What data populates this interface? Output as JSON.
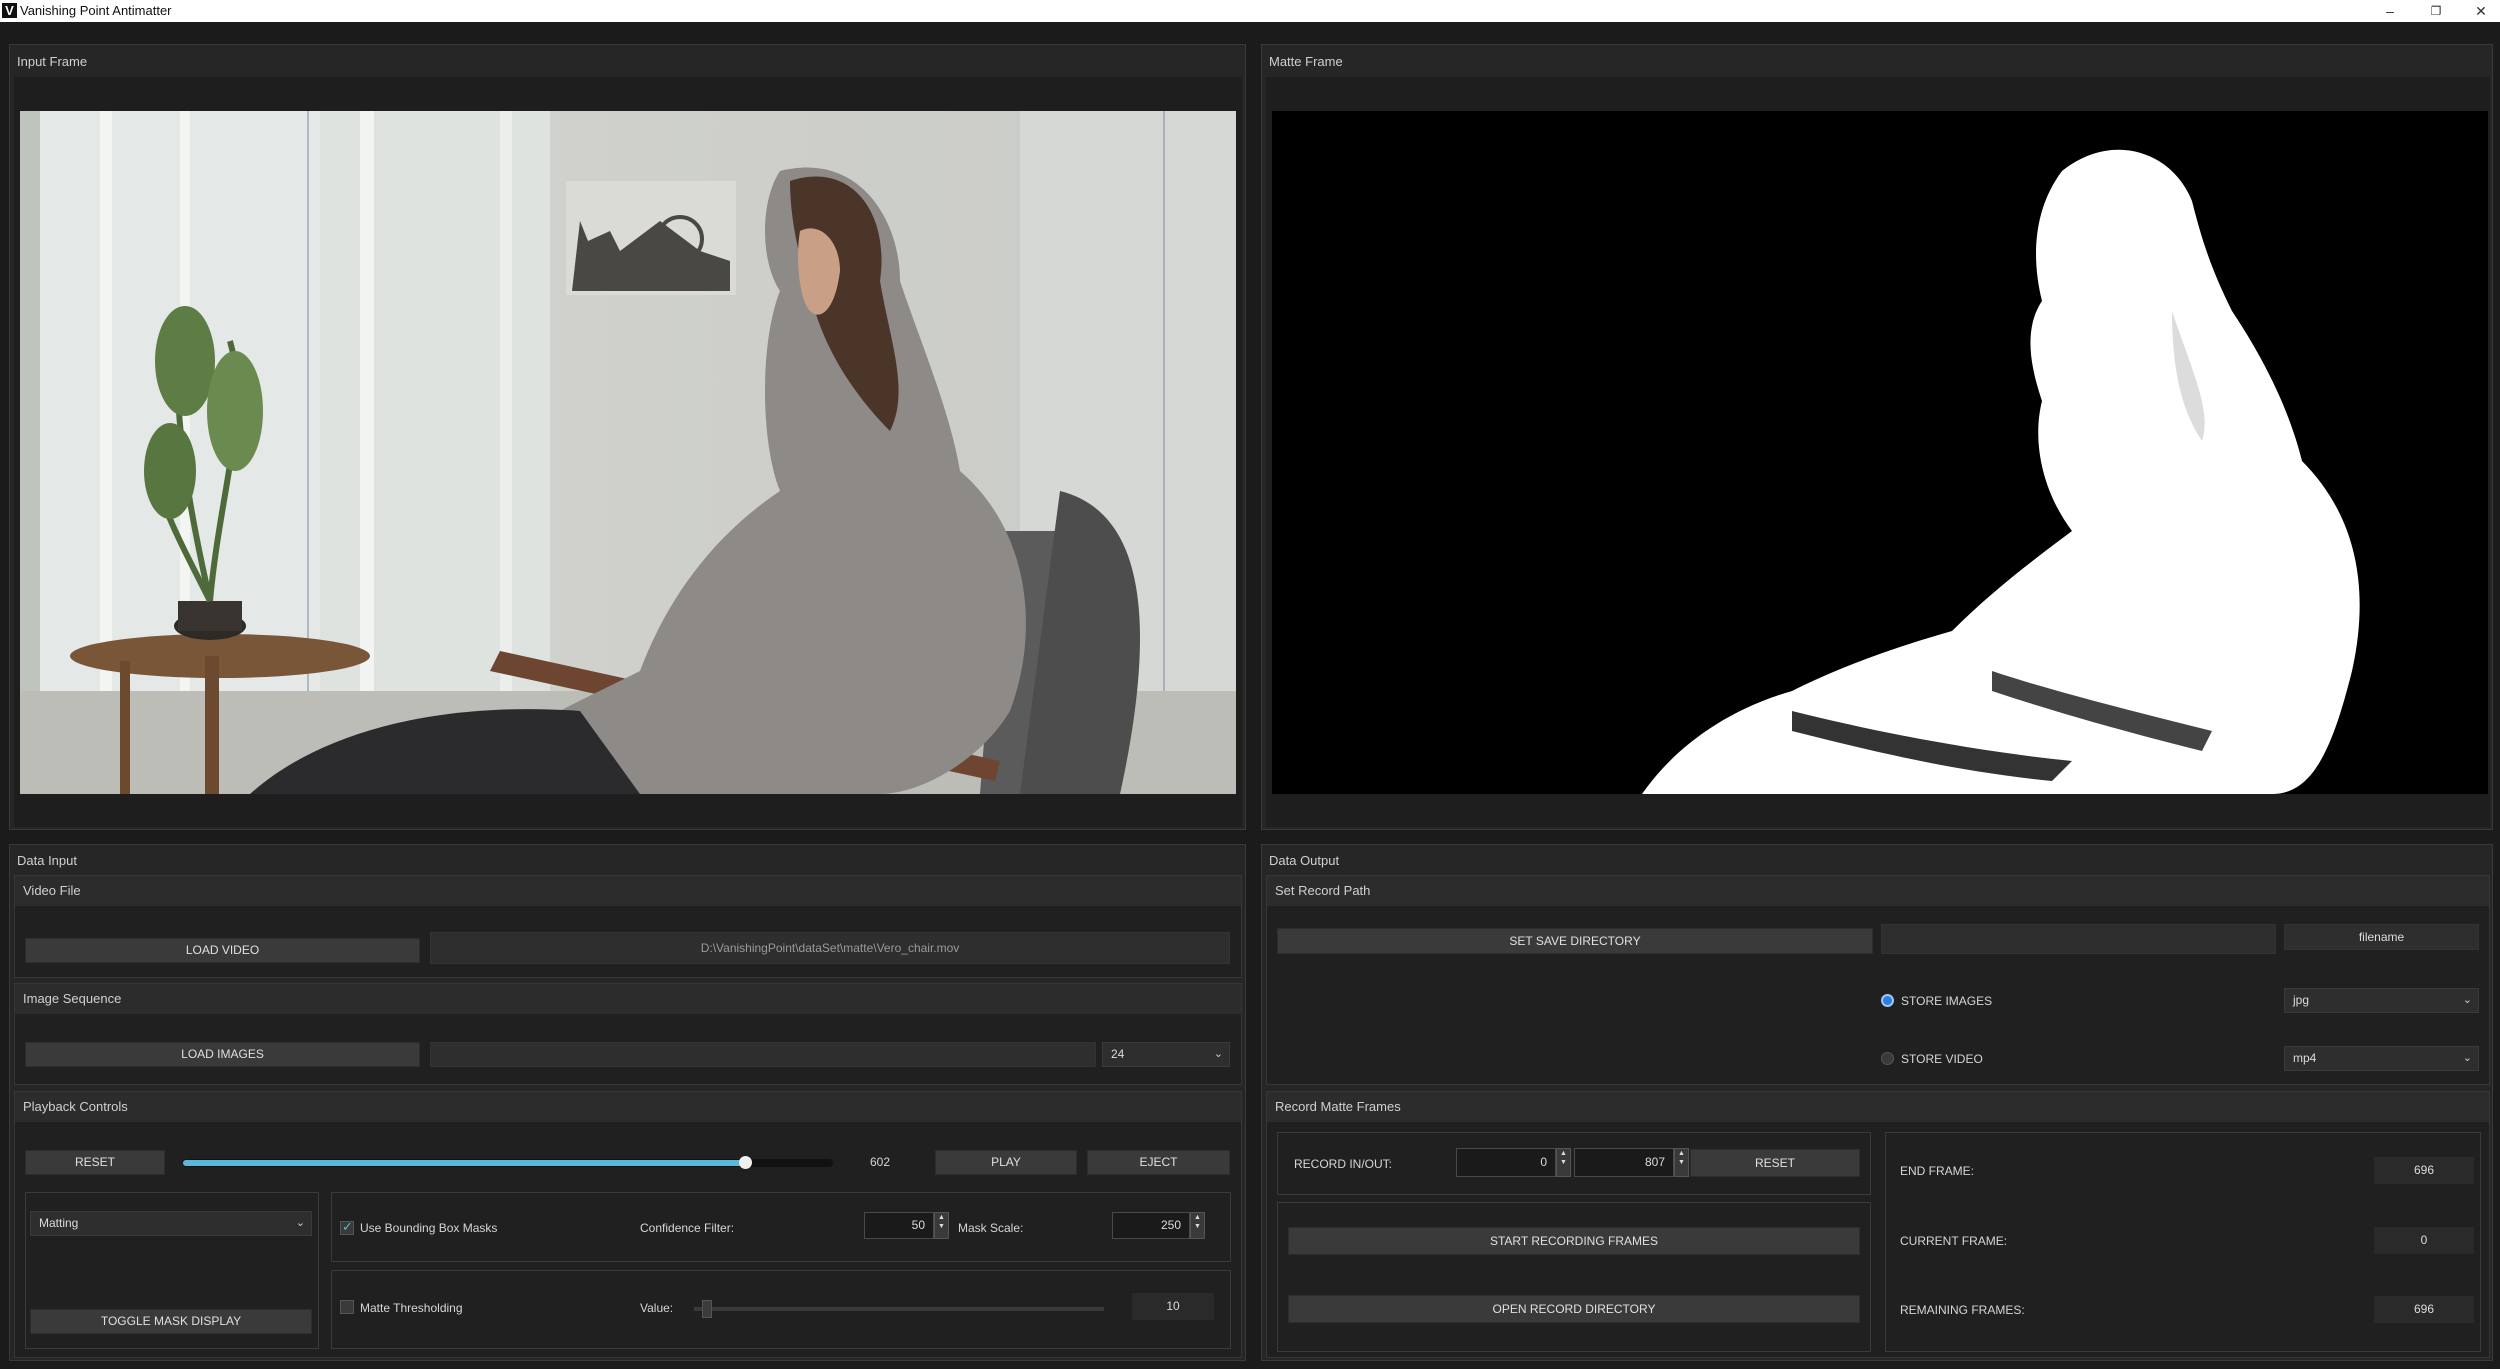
{
  "window": {
    "title": "Vanishing Point Antimatter",
    "logo": "V",
    "controls": {
      "minimize": "–",
      "restore": "❐",
      "close": "✕"
    }
  },
  "input_frame": {
    "title": "Input Frame"
  },
  "matte_frame": {
    "title": "Matte Frame"
  },
  "data_input": {
    "title": "Data Input",
    "video_file": {
      "header": "Video File",
      "load_button": "LOAD VIDEO",
      "path": "D:\\VanishingPoint\\dataSet\\matte\\Vero_chair.mov"
    },
    "image_sequence": {
      "header": "Image Sequence",
      "load_button": "LOAD IMAGES",
      "path": "",
      "fps": "24"
    },
    "playback": {
      "header": "Playback Controls",
      "reset_button": "RESET",
      "frame_value": "602",
      "frame_progress": 0.865,
      "play_button": "PLAY",
      "eject_button": "EJECT",
      "mode": "Matting",
      "toggle_mask_button": "TOGGLE MASK DISPLAY",
      "use_bbox_label": "Use Bounding Box Masks",
      "use_bbox_checked": true,
      "confidence_label": "Confidence Filter:",
      "confidence_value": "50",
      "mask_scale_label": "Mask Scale:",
      "mask_scale_value": "250",
      "matte_threshold_label": "Matte Thresholding",
      "matte_threshold_checked": false,
      "value_label": "Value:",
      "threshold_value": "10",
      "threshold_progress": 0.02
    }
  },
  "data_output": {
    "title": "Data Output",
    "record_path": {
      "header": "Set Record Path",
      "save_dir_button": "SET SAVE DIRECTORY",
      "save_dir_value": "",
      "filename": "filename",
      "store_images_label": "STORE IMAGES",
      "store_images_selected": true,
      "image_format": "jpg",
      "store_video_label": "STORE VIDEO",
      "store_video_selected": false,
      "video_format": "mp4"
    },
    "record_matte": {
      "header": "Record Matte Frames",
      "record_inout_label": "RECORD IN/OUT:",
      "record_in": "0",
      "record_out": "807",
      "reset_button": "RESET",
      "start_button": "START RECORDING FRAMES",
      "open_dir_button": "OPEN RECORD DIRECTORY",
      "end_frame_label": "END FRAME:",
      "end_frame": "696",
      "current_frame_label": "CURRENT FRAME:",
      "current_frame": "0",
      "remaining_label": "REMAINING FRAMES:",
      "remaining": "696"
    }
  },
  "colors": {
    "accent": "#2a7fe0",
    "slider_fill": "#5ab8d8",
    "background": "#1b1b1b",
    "panel": "#262626"
  }
}
